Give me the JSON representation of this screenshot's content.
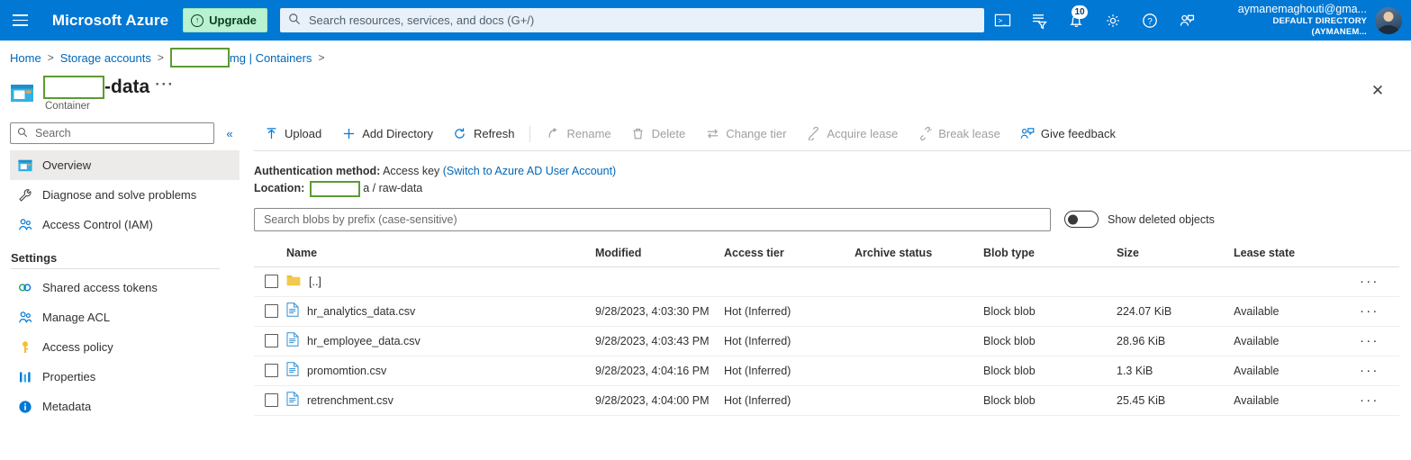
{
  "topbar": {
    "menu_icon": "hamburger-icon",
    "brand": "Microsoft Azure",
    "upgrade_label": "Upgrade",
    "search_placeholder": "Search resources, services, and docs (G+/)",
    "search_value": "",
    "icons": [
      {
        "name": "cloud-shell-icon",
        "glyph": ">_"
      },
      {
        "name": "directories-subscriptions-icon",
        "glyph": "filter"
      },
      {
        "name": "notifications-icon",
        "glyph": "bell",
        "badge": "10"
      },
      {
        "name": "settings-icon",
        "glyph": "gear"
      },
      {
        "name": "help-icon",
        "glyph": "question"
      },
      {
        "name": "feedback-icon",
        "glyph": "person-feedback"
      }
    ],
    "account_name": "aymanemaghouti@gma...",
    "account_directory": "DEFAULT DIRECTORY (AYMANEM..."
  },
  "breadcrumb": {
    "items": [
      {
        "label": "Home",
        "redacted": false
      },
      {
        "label": "Storage accounts",
        "redacted": false
      },
      {
        "label": "",
        "redacted": true,
        "suffix": "mg | Containers"
      }
    ],
    "separator": ">"
  },
  "page": {
    "title_redacted": true,
    "title_suffix": "-data",
    "subtitle": "Container",
    "ellipsis": "···",
    "close_label": "✕"
  },
  "sidebar": {
    "search_placeholder": "Search",
    "search_value": "",
    "collapse_label": "«",
    "items": [
      {
        "label": "Overview",
        "icon": "container-icon",
        "active": true
      },
      {
        "label": "Diagnose and solve problems",
        "icon": "wrench-icon",
        "active": false
      },
      {
        "label": "Access Control (IAM)",
        "icon": "people-icon",
        "active": false
      }
    ],
    "group_title": "Settings",
    "settings_items": [
      {
        "label": "Shared access tokens",
        "icon": "token-icon"
      },
      {
        "label": "Manage ACL",
        "icon": "people-icon"
      },
      {
        "label": "Access policy",
        "icon": "key-icon"
      },
      {
        "label": "Properties",
        "icon": "properties-icon"
      },
      {
        "label": "Metadata",
        "icon": "info-icon"
      }
    ]
  },
  "toolbar": {
    "commands": [
      {
        "label": "Upload",
        "icon": "upload-icon",
        "disabled": false
      },
      {
        "label": "Add Directory",
        "icon": "plus-icon",
        "disabled": false
      },
      {
        "label": "Refresh",
        "icon": "refresh-icon",
        "disabled": false
      },
      {
        "label": "Rename",
        "icon": "rename-icon",
        "disabled": true
      },
      {
        "label": "Delete",
        "icon": "trash-icon",
        "disabled": true
      },
      {
        "label": "Change tier",
        "icon": "change-tier-icon",
        "disabled": true
      },
      {
        "label": "Acquire lease",
        "icon": "lease-icon",
        "disabled": true
      },
      {
        "label": "Break lease",
        "icon": "break-lease-icon",
        "disabled": true
      },
      {
        "label": "Give feedback",
        "icon": "feedback-icon",
        "disabled": false
      }
    ]
  },
  "info": {
    "auth_label": "Authentication method:",
    "auth_value": "Access key",
    "auth_switch_link": "(Switch to Azure AD User Account)",
    "location_label": "Location:",
    "location_redacted": true,
    "location_suffix": "a  /  raw-data"
  },
  "filter": {
    "blob_search_placeholder": "Search blobs by prefix (case-sensitive)",
    "blob_search_value": "",
    "toggle_label": "Show deleted objects",
    "toggle_on": false
  },
  "table": {
    "columns": [
      "Name",
      "Modified",
      "Access tier",
      "Archive status",
      "Blob type",
      "Size",
      "Lease state"
    ],
    "more_glyph": "···",
    "rows": [
      {
        "name": "[..]",
        "icon": "folder-icon",
        "modified": "",
        "access_tier": "",
        "archive_status": "",
        "blob_type": "",
        "size": "",
        "lease_state": ""
      },
      {
        "name": "hr_analytics_data.csv",
        "icon": "file-icon",
        "modified": "9/28/2023, 4:03:30 PM",
        "access_tier": "Hot (Inferred)",
        "archive_status": "",
        "blob_type": "Block blob",
        "size": "224.07 KiB",
        "lease_state": "Available"
      },
      {
        "name": "hr_employee_data.csv",
        "icon": "file-icon",
        "modified": "9/28/2023, 4:03:43 PM",
        "access_tier": "Hot (Inferred)",
        "archive_status": "",
        "blob_type": "Block blob",
        "size": "28.96 KiB",
        "lease_state": "Available"
      },
      {
        "name": "promomtion.csv",
        "icon": "file-icon",
        "modified": "9/28/2023, 4:04:16 PM",
        "access_tier": "Hot (Inferred)",
        "archive_status": "",
        "blob_type": "Block blob",
        "size": "1.3 KiB",
        "lease_state": "Available"
      },
      {
        "name": "retrenchment.csv",
        "icon": "file-icon",
        "modified": "9/28/2023, 4:04:00 PM",
        "access_tier": "Hot (Inferred)",
        "archive_status": "",
        "blob_type": "Block blob",
        "size": "25.45 KiB",
        "lease_state": "Available"
      }
    ]
  },
  "colors": {
    "azure_blue": "#0078d4",
    "upgrade_green": "#b9f2d0",
    "redaction_green": "#5b9b33",
    "link_blue": "#0067b8",
    "folder_yellow": "#f2c94c",
    "active_row": "#edebe9"
  }
}
